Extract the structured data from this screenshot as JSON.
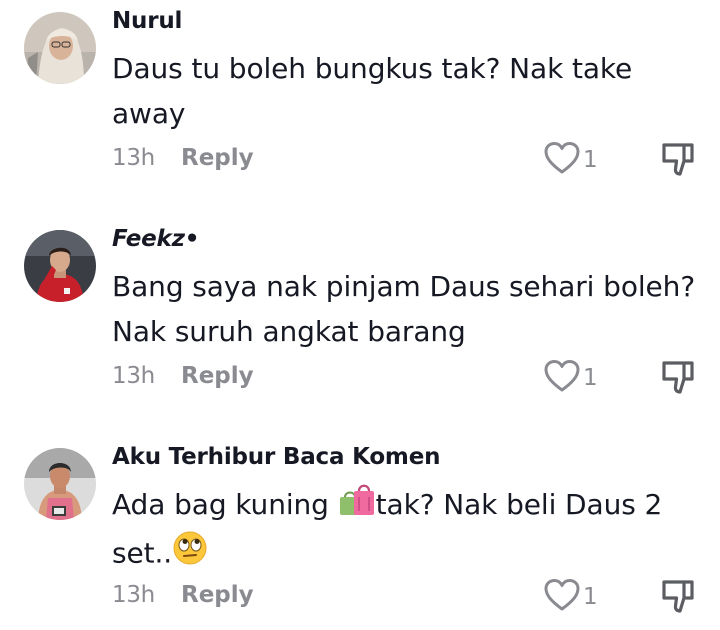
{
  "comments": [
    {
      "username": "Nurul",
      "text_lines": [
        "Daus tu boleh bungkus tak? Nak take",
        "away"
      ],
      "time": "13h",
      "reply_label": "Reply",
      "likes": "1"
    },
    {
      "username": "Feekz•",
      "text_lines": [
        "Bang saya nak pinjam Daus sehari boleh?",
        "Nak suruh angkat barang"
      ],
      "time": "13h",
      "reply_label": "Reply",
      "likes": "1"
    },
    {
      "username": "Aku Terhibur Baca Komen",
      "text_line1_before": "Ada bag kuning ",
      "text_line1_after": "tak? Nak beli Daus 2",
      "text_line2": "set..",
      "time": "13h",
      "reply_label": "Reply",
      "likes": "1"
    }
  ],
  "icons": {
    "like": "heart-outline-icon",
    "dislike": "thumbs-down-icon",
    "emoji_1": "shopping-bags-emoji",
    "emoji_2": "face-with-rolling-eyes-emoji"
  },
  "colors": {
    "text": "#161823",
    "secondary": "#8a8b91",
    "background": "#ffffff"
  }
}
